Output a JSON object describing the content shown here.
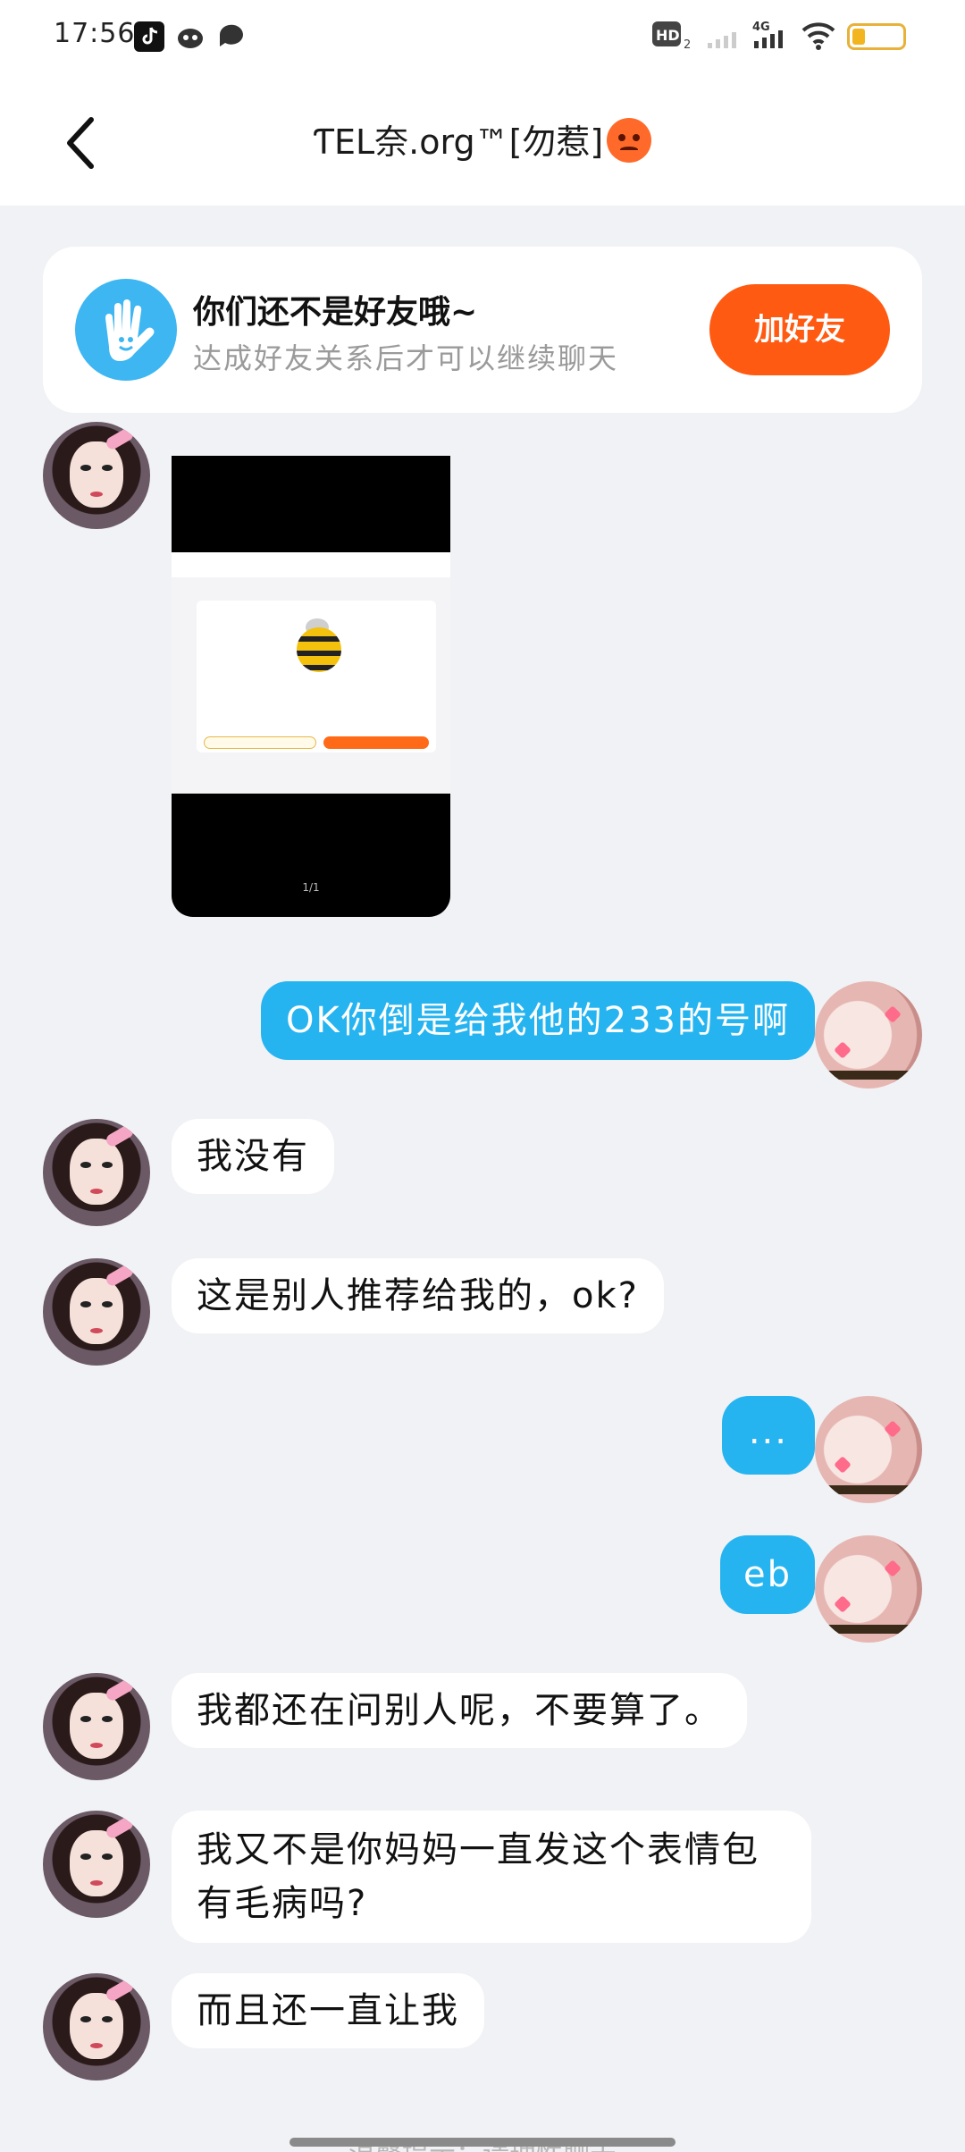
{
  "status_bar": {
    "time": "17:56",
    "left_icons": [
      "tiktok-icon",
      "cat-app-icon",
      "chat-app-icon"
    ],
    "right_icons": [
      "hd-icon",
      "signal-weak-icon",
      "signal-4g-icon",
      "wifi-icon",
      "battery-icon"
    ],
    "hd_label": "HD",
    "hd_sub": "2",
    "network_label": "4G"
  },
  "header": {
    "back_icon": "chevron-left-icon",
    "title": "ƬEL奈.org™[勿惹]"
  },
  "friend_prompt": {
    "title": "你们还不是好友哦~",
    "subtitle": "达成好友关系后才可以继续聊天",
    "button_label": "加好友",
    "icon": "waving-hand-icon"
  },
  "image_message": {
    "counter": "1/1"
  },
  "messages": [
    {
      "side": "out",
      "text": "OK你倒是给我他的233的号啊"
    },
    {
      "side": "in",
      "text": "我没有"
    },
    {
      "side": "in",
      "text": "这是别人推荐给我的，ok?"
    },
    {
      "side": "out",
      "text": "..."
    },
    {
      "side": "out",
      "text": "eb"
    },
    {
      "side": "in",
      "text": "我都还在问别人呢，不要算了。"
    },
    {
      "side": "in",
      "text": "我又不是你妈妈一直发这个表情包有毛病吗?"
    },
    {
      "side": "in",
      "text": "而且还一直让我"
    }
  ],
  "bottom_hint": "温馨提示：请理性聊天",
  "colors": {
    "background": "#f1f2f5",
    "outgoing_bubble": "#26b4f0",
    "add_friend_button": "#ff5a12",
    "hand_icon_bg": "#3db6f2"
  }
}
